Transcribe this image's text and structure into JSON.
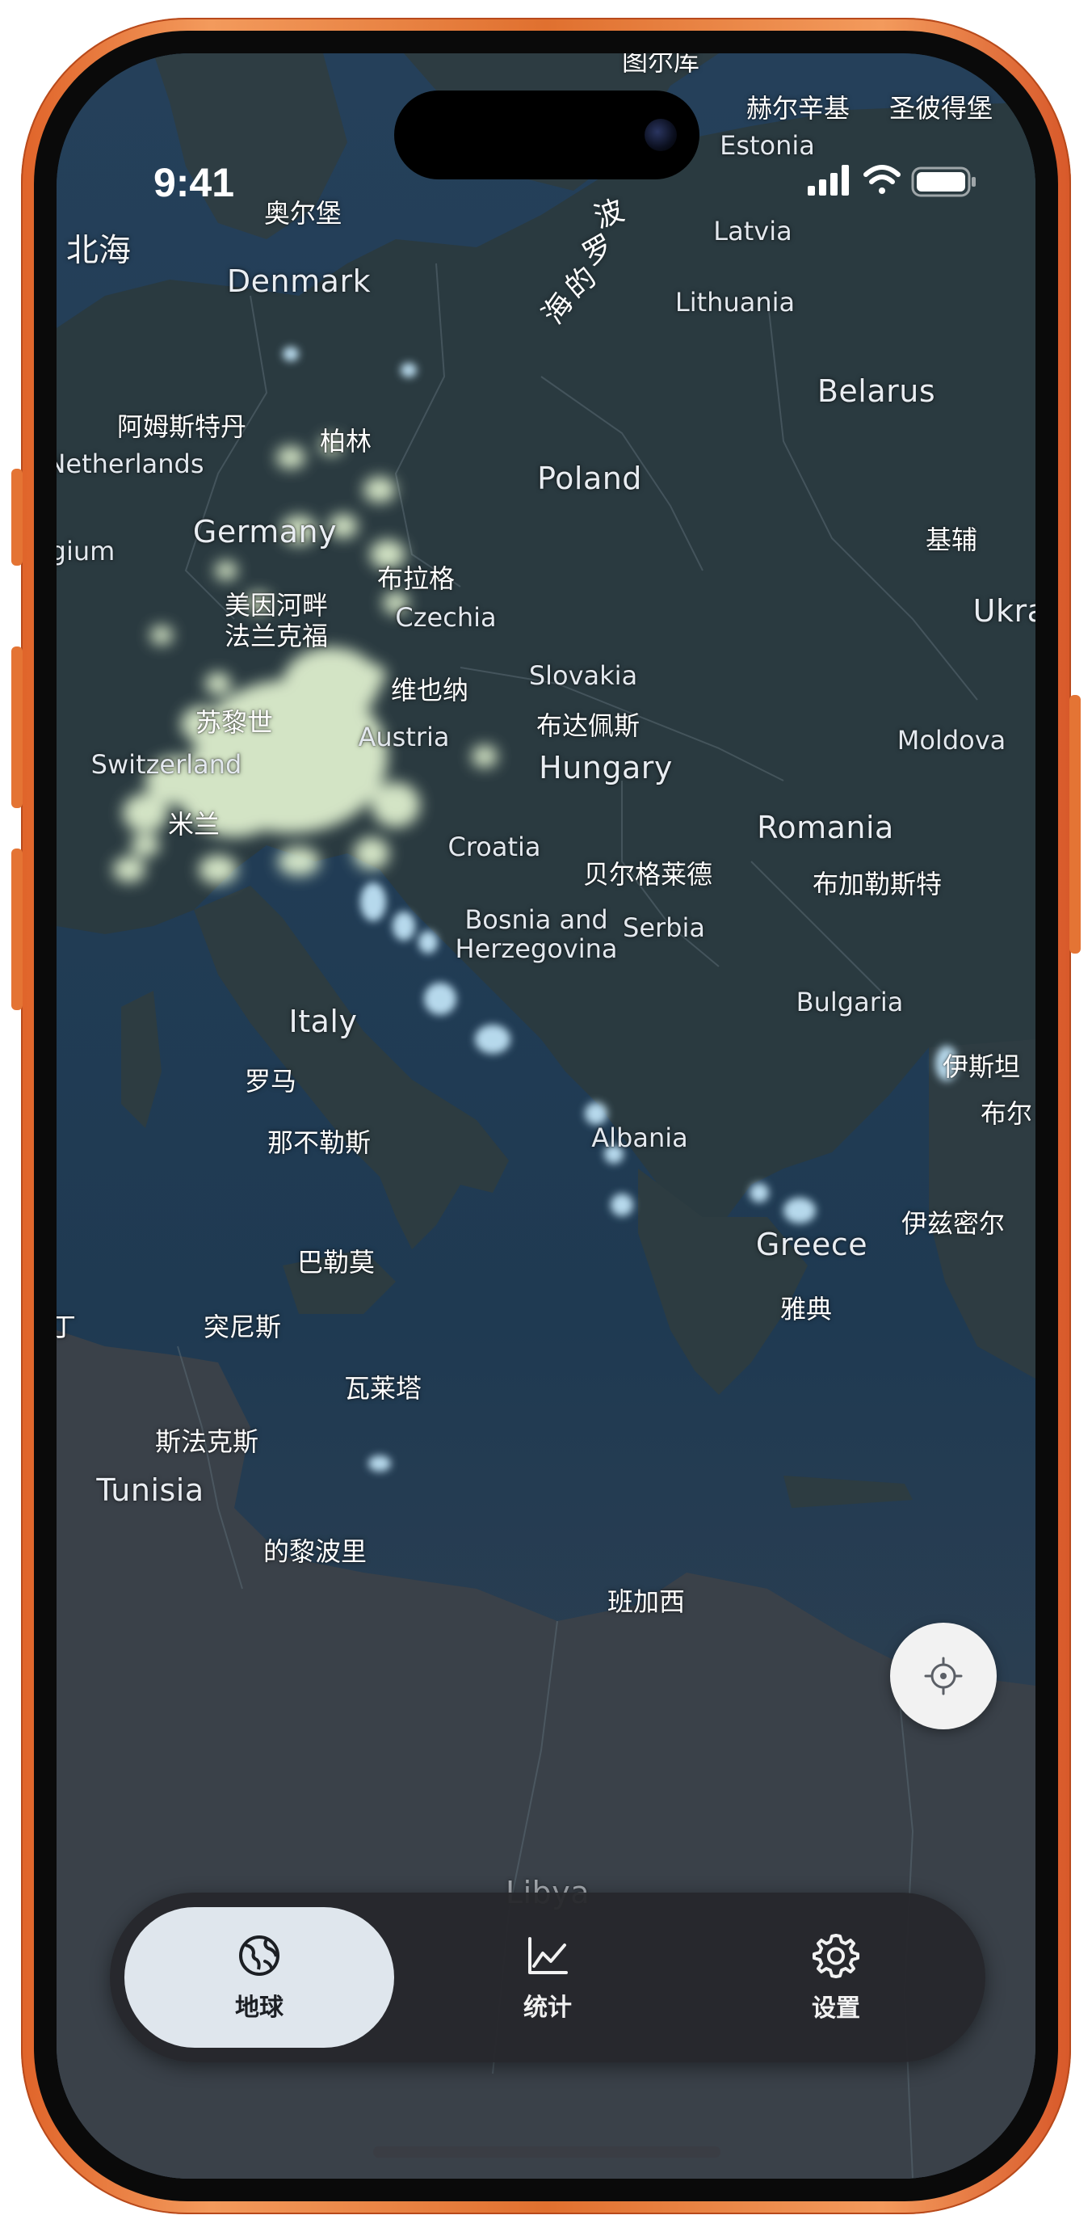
{
  "status_bar": {
    "time": "9:41",
    "icons": [
      "cellular-signal-icon",
      "wifi-icon",
      "battery-icon"
    ]
  },
  "map": {
    "sea_labels": {
      "north_sea": "北海",
      "baltic_sea": [
        "波",
        "罗",
        "的",
        "海"
      ]
    },
    "countries": {
      "denmark": "Denmark",
      "latvia": "Latvia",
      "lithuania": "Lithuania",
      "belarus": "Belarus",
      "netherlands": "Netherlands",
      "poland": "Poland",
      "belgium": "gium",
      "germany": "Germany",
      "czechia": "Czechia",
      "ukraine": "Ukra",
      "slovakia": "Slovakia",
      "moldova": "Moldova",
      "switzerland": "Switzerland",
      "austria": "Austria",
      "hungary": "Hungary",
      "romania": "Romania",
      "croatia": "Croatia",
      "bosnia": "Bosnia and\nHerzegovina",
      "serbia": "Serbia",
      "bulgaria": "Bulgaria",
      "italy": "Italy",
      "albania": "Albania",
      "greece": "Greece",
      "tunisia": "Tunisia",
      "libya": "Libya",
      "estonia": "Estonia"
    },
    "cities": {
      "oslo": "奥尔堡",
      "copenhagen_top": "图尔库",
      "helsinki": "赫尔辛基",
      "st_petersburg": "圣彼得堡",
      "amsterdam": "阿姆斯特丹",
      "berlin": "柏林",
      "kyiv": "基辅",
      "prague": "布拉格",
      "frankfurt": "美因河畔\n法兰克福",
      "vienna": "维也纳",
      "zurich": "苏黎世",
      "budapest": "布达佩斯",
      "milan": "米兰",
      "belgrade": "贝尔格莱德",
      "bucharest": "布加勒斯特",
      "istanbul": "伊斯坦",
      "bursa": "布尔",
      "rome": "罗马",
      "naples": "那不勒斯",
      "izmir": "伊兹密尔",
      "palermo": "巴勒莫",
      "athens": "雅典",
      "tunis": "突尼斯",
      "valletta": "瓦莱塔",
      "sfax": "斯法克斯",
      "tripoli": "的黎波里",
      "benghazi": "班加西",
      "annaba": "丁"
    }
  },
  "locate_button": {
    "icon": "crosshair-icon"
  },
  "tab_bar": {
    "tabs": [
      {
        "label": "地球",
        "icon": "globe-icon",
        "active": true
      },
      {
        "label": "统计",
        "icon": "line-chart-icon",
        "active": false
      },
      {
        "label": "设置",
        "icon": "gear-icon",
        "active": false
      }
    ]
  },
  "colors": {
    "frame": "#e0702f",
    "sea": "#1f3a52",
    "land": "#2b3a40",
    "heat_glow": "#e6f7d4",
    "tab_bar": "#26282c",
    "tab_active": "#dfe6ed"
  }
}
